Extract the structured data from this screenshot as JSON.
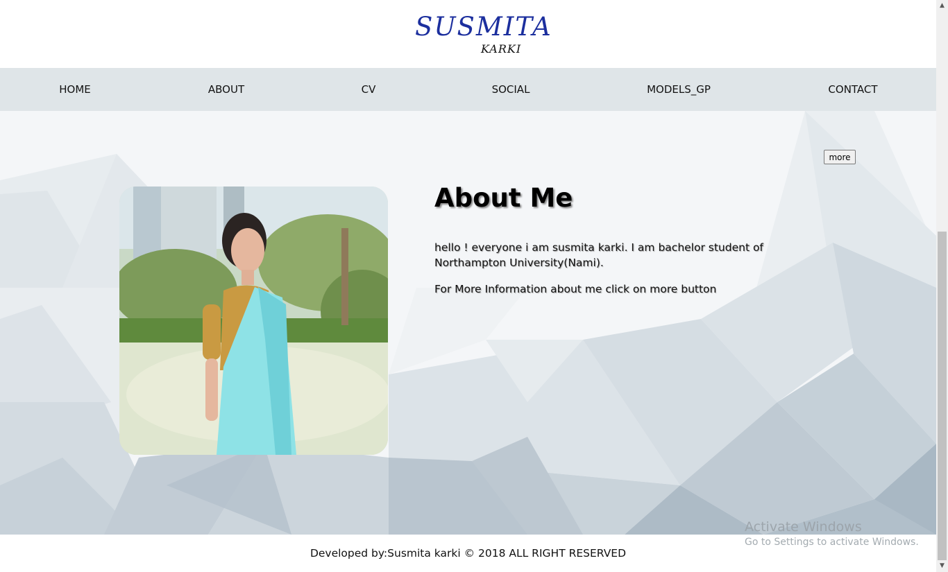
{
  "header": {
    "logo_first": "SUSMITA",
    "logo_last": "KARKI"
  },
  "nav": {
    "items": [
      {
        "label": "HOME"
      },
      {
        "label": "ABOUT"
      },
      {
        "label": "CV"
      },
      {
        "label": "SOCIAL"
      },
      {
        "label": "MODELS_GP"
      },
      {
        "label": "CONTACT"
      }
    ]
  },
  "about": {
    "more_label": "more",
    "title": "About Me",
    "paragraph1": "hello ! everyone i am susmita karki. I am bachelor student of Northampton University(Nami).",
    "paragraph2": "For More Information about me click on more button"
  },
  "footer": {
    "text": "Developed by:Susmita karki © 2018 ALL RIGHT RESERVED"
  },
  "watermark": {
    "title": "Activate Windows",
    "subtitle": "Go to Settings to activate Windows."
  },
  "colors": {
    "logo_blue": "#1c2f9e",
    "nav_bg": "#dfe5e8",
    "hero_bg": "#f4f6f8"
  },
  "icons": {
    "scroll_up": "triangle-up-icon",
    "scroll_down": "triangle-down-icon"
  }
}
